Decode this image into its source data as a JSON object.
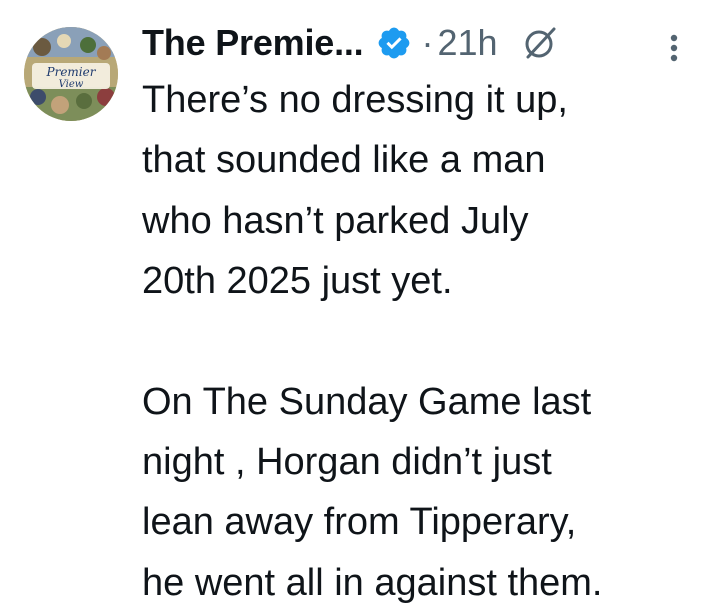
{
  "author": {
    "display_name": "The Premie...",
    "verified": true,
    "avatar_text": "Premier View",
    "time_separator": "·",
    "timestamp": "21h"
  },
  "icons": {
    "verified": "verified-badge-icon",
    "grok": "grok-icon",
    "more": "more-vertical-icon"
  },
  "colors": {
    "verified_blue": "#1d9bf0",
    "text": "#0f1419",
    "secondary": "#536471"
  },
  "tweet": {
    "paragraph_1_lines": [
      "There’s no dressing it up,",
      "that sounded like a man",
      "who hasn’t parked July",
      "20th 2025 just yet."
    ],
    "paragraph_2_lines": [
      "On The Sunday Game last",
      "night , Horgan didn’t just",
      "lean away from Tipperary,",
      "he went all in against them."
    ]
  }
}
